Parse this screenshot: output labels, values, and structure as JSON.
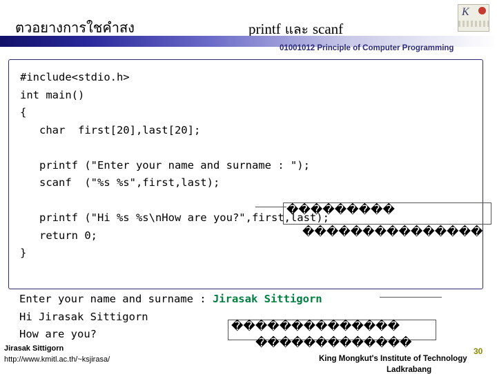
{
  "header": {
    "title_left": "ตวอยางการใชคำสง",
    "title_center_thai_1": "printf",
    "title_center_thai_2": " และ ",
    "title_center_thai_3": "scanf",
    "subtitle": "01001012 Principle of Computer Programming",
    "logo_letter": "K"
  },
  "code": {
    "lines": [
      "#include<stdio.h>",
      "int main()",
      "{",
      "   char  first[20],last[20];",
      "",
      "   printf (\"Enter your name and surname : \");",
      "   scanf  (\"%s %s\",first,last);",
      "",
      "   printf (\"Hi %s %s\\nHow are you?\",first,last);",
      "   return 0;",
      "}"
    ]
  },
  "output": {
    "line1_prompt": "Enter your name and surname : ",
    "line1_input": "Jirasak Sittigorn",
    "line2": "Hi Jirasak Sittigorn",
    "line3": "How are you?"
  },
  "annotations": {
    "top": "���������",
    "middle": "���������������",
    "bottom_1": "��������������",
    "bottom_2": "�������������"
  },
  "footer": {
    "author": "Jirasak Sittigorn",
    "url": "http://www.kmitl.ac.th/~ksjirasa/",
    "org_line1": "King Mongkut's Institute of Technology",
    "org_line2": "Ladkrabang",
    "page_number": "30"
  },
  "colors": {
    "accent": "#2b2b7a",
    "output_green": "#008040",
    "page_number": "#8a8a00"
  }
}
